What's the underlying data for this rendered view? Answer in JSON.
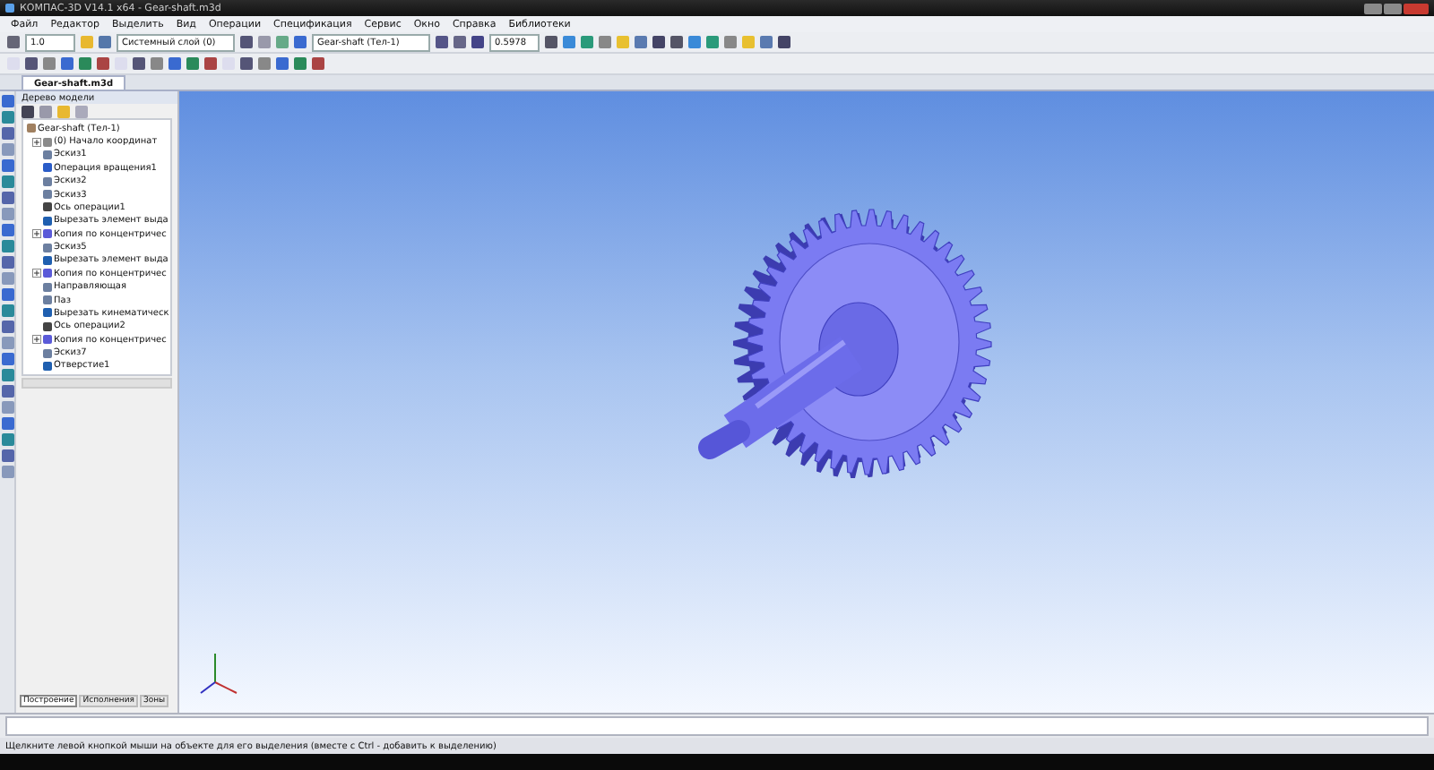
{
  "window": {
    "title": "КОМПАС-3D V14.1 x64 - Gear-shaft.m3d"
  },
  "menu": [
    "Файл",
    "Редактор",
    "Выделить",
    "Вид",
    "Операции",
    "Спецификация",
    "Сервис",
    "Окно",
    "Справка",
    "Библиотеки"
  ],
  "toolbar": {
    "step": "1.0",
    "layer": "Системный слой (0)",
    "body": "Gear-shaft (Тел-1)",
    "zoom": "0.5978"
  },
  "document_tab": {
    "label": "Gear-shaft.m3d",
    "selected": true
  },
  "tree": {
    "title": "Дерево модели",
    "root": "Gear-shaft (Тел-1)",
    "items": [
      {
        "label": "(0) Начало координат",
        "kind": "origin",
        "expander": true
      },
      {
        "label": "Эскиз1",
        "kind": "sketch",
        "expander": false
      },
      {
        "label": "Операция вращения1",
        "kind": "revolve",
        "expander": false
      },
      {
        "label": "Эскиз2",
        "kind": "sketch",
        "expander": false
      },
      {
        "label": "Эскиз3",
        "kind": "sketch",
        "expander": false
      },
      {
        "label": "Ось операции1",
        "kind": "axis",
        "expander": false
      },
      {
        "label": "Вырезать элемент выда",
        "kind": "cut",
        "expander": false
      },
      {
        "label": "Копия по концентричес",
        "kind": "pattern",
        "expander": true
      },
      {
        "label": "Эскиз5",
        "kind": "sketch",
        "expander": false
      },
      {
        "label": "Вырезать элемент выда",
        "kind": "cut",
        "expander": false
      },
      {
        "label": "Копия по концентричес",
        "kind": "pattern",
        "expander": true
      },
      {
        "label": "Направляющая",
        "kind": "sketch",
        "expander": false
      },
      {
        "label": "Паз",
        "kind": "sketch",
        "expander": false
      },
      {
        "label": "Вырезать кинематическ",
        "kind": "cut",
        "expander": false
      },
      {
        "label": "Ось операции2",
        "kind": "axis",
        "expander": false
      },
      {
        "label": "Копия по концентричес",
        "kind": "pattern",
        "expander": true
      },
      {
        "label": "Эскиз7",
        "kind": "sketch",
        "expander": false
      },
      {
        "label": "Отверстие1",
        "kind": "cut",
        "expander": false
      }
    ]
  },
  "panel_tabs": [
    {
      "label": "Построение",
      "selected": true
    },
    {
      "label": "Исполнения",
      "selected": false
    },
    {
      "label": "Зоны",
      "selected": false
    }
  ],
  "status_bar": "Щелкните левой кнопкой мыши на объекте для его выделения (вместе с Ctrl - добавить к выделению)"
}
